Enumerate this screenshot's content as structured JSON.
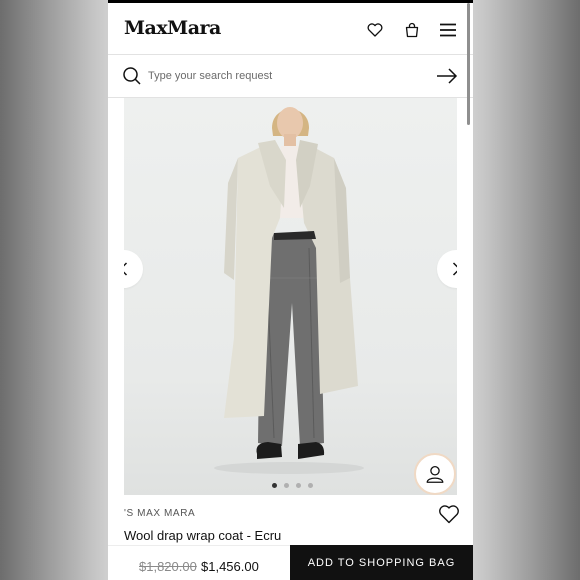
{
  "header": {
    "logo": "MaxMara",
    "icons": [
      "heart-icon",
      "shopping-bag-icon",
      "menu-icon"
    ]
  },
  "search": {
    "placeholder": "Type your search request",
    "icon": "search-icon",
    "submit_icon": "arrow-right-icon"
  },
  "gallery": {
    "prev_icon": "chevron-left-icon",
    "next_icon": "chevron-right-icon",
    "dots_total": 4,
    "dots_active": 1,
    "assistant_icon": "person-icon"
  },
  "product": {
    "brand": "'S MAX MARA",
    "name": "Wool drap wrap coat - Ecru",
    "old_price": "$1,820.00",
    "price": "$1,456.00",
    "wishlist_icon": "heart-icon"
  },
  "cta": {
    "add_to_bag": "ADD TO SHOPPING BAG"
  },
  "colors": {
    "coat": "#e3e1d6",
    "cta_background": "#111111",
    "avatar_ring": "#f0d9c4"
  }
}
